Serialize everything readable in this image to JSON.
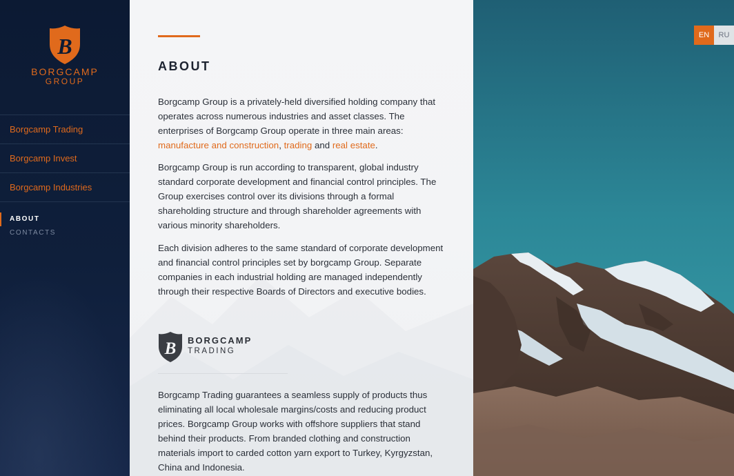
{
  "brand": {
    "name": "BORGCAMP",
    "sub": "GROUP",
    "monogram": "B",
    "icon": "shield-b-logo",
    "accent": "#e06a1c"
  },
  "divisions": [
    {
      "label": "Borgcamp Trading"
    },
    {
      "label": "Borgcamp Invest"
    },
    {
      "label": "Borgcamp Industries"
    }
  ],
  "subnav": [
    {
      "label": "ABOUT",
      "active": true
    },
    {
      "label": "CONTACTS",
      "active": false
    }
  ],
  "content": {
    "title": "ABOUT",
    "p1": {
      "text_a": "Borgcamp Group is a privately-held diversified holding company that operates across numerous industries and asset classes. The enterprises of Borgcamp Group operate in three main areas: ",
      "link1": "manufacture and construction",
      "text_b": ", ",
      "link2": "trading",
      "text_c": " and ",
      "link3": "real estate",
      "text_d": "."
    },
    "p2": "Borgcamp Group is run according to transparent, global industry standard corporate development and financial control principles. The Group exercises control over its divisions through a formal shareholding structure and through shareholder agreements with various minority shareholders.",
    "p3": "Each division adheres to the same standard of corporate development and financial control principles set by borgcamp Group. Separate companies in each industrial holding are managed independently through their respective Boards of Directors and executive bodies.",
    "trading_logo": {
      "name": "BORGCAMP",
      "sub": "TRADING",
      "monogram": "B"
    },
    "p4": "Borgcamp Trading guarantees a seamless supply of products thus eliminating all local wholesale margins/costs and reducing product prices. Borgcamp Group works with offshore suppliers that stand behind their products. From branded clothing and construction materials import to carded cotton yarn export to Turkey, Kyrgyzstan, China and Indonesia."
  },
  "language": {
    "options": [
      "EN",
      "RU"
    ],
    "selected": "EN"
  },
  "colors": {
    "sidebar": "#0d1b33",
    "accent": "#e06a1c",
    "panel": "#f4f5f7",
    "sky": "#2f8b9a"
  }
}
